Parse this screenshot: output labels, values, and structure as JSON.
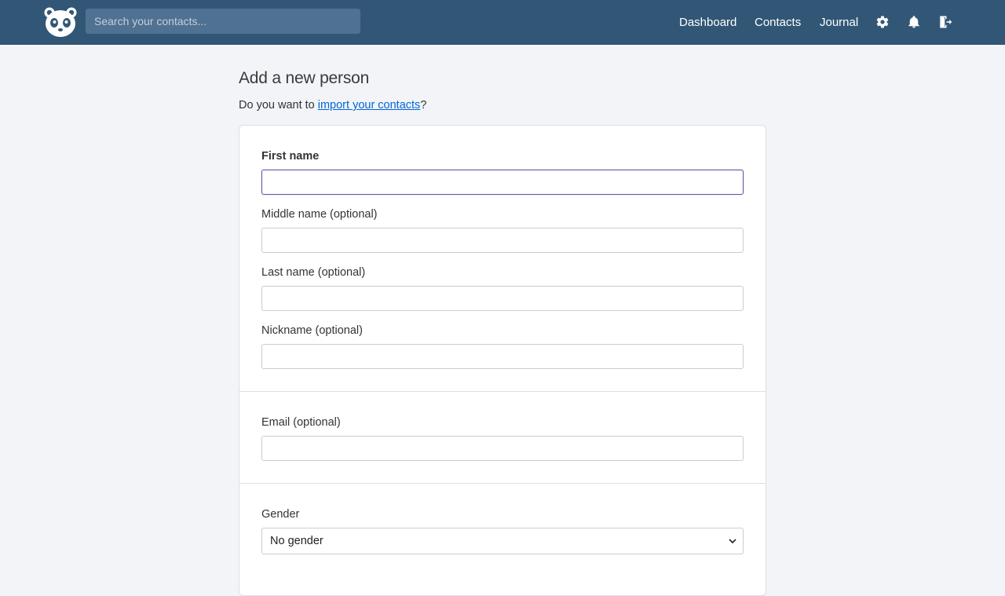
{
  "header": {
    "search_placeholder": "Search your contacts...",
    "nav": {
      "dashboard": "Dashboard",
      "contacts": "Contacts",
      "journal": "Journal"
    },
    "icons": [
      "panda-logo-icon",
      "gear-icon",
      "bell-icon",
      "logout-icon"
    ],
    "background_color": "#325776"
  },
  "main": {
    "title": "Add a new person",
    "import_prefix": "Do you want to ",
    "import_link": "import your contacts",
    "import_suffix": "?",
    "fields": {
      "first_name": {
        "label": "First name",
        "value": ""
      },
      "middle_name": {
        "label": "Middle name (optional)",
        "value": ""
      },
      "last_name": {
        "label": "Last name (optional)",
        "value": ""
      },
      "nickname": {
        "label": "Nickname (optional)",
        "value": ""
      },
      "email": {
        "label": "Email (optional)",
        "value": ""
      },
      "gender": {
        "label": "Gender",
        "selected": "No gender"
      }
    },
    "link_color": "#0366d6"
  }
}
